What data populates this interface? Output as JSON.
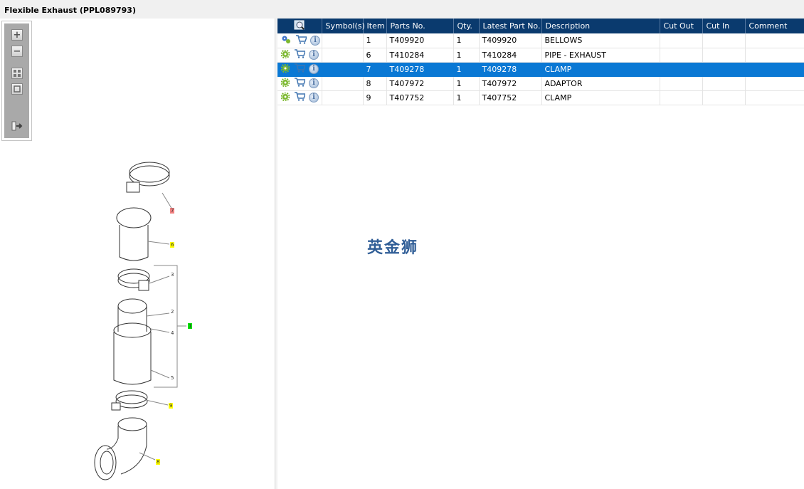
{
  "window": {
    "title": "Flexible Exhaust (PPL089793)"
  },
  "toolbar": {
    "items": [
      {
        "icon": "zoom-in-icon"
      },
      {
        "icon": "zoom-out-icon"
      },
      {
        "icon": "fit-all-icon"
      },
      {
        "icon": "actual-size-icon"
      },
      {
        "icon": "export-list-icon"
      }
    ]
  },
  "table": {
    "columns": [
      "Symbol(s)",
      "Item",
      "Parts No.",
      "Qty.",
      "Latest Part No.",
      "Description",
      "Cut Out",
      "Cut In",
      "Comment"
    ],
    "rows": [
      {
        "item": "1",
        "part": "T409920",
        "qty": "1",
        "latest": "T409920",
        "desc": "BELLOWS",
        "selected": false
      },
      {
        "item": "6",
        "part": "T410284",
        "qty": "1",
        "latest": "T410284",
        "desc": "PIPE - EXHAUST",
        "selected": false
      },
      {
        "item": "7",
        "part": "T409278",
        "qty": "1",
        "latest": "T409278",
        "desc": "CLAMP",
        "selected": true
      },
      {
        "item": "8",
        "part": "T407972",
        "qty": "1",
        "latest": "T407972",
        "desc": "ADAPTOR",
        "selected": false
      },
      {
        "item": "9",
        "part": "T407752",
        "qty": "1",
        "latest": "T407752",
        "desc": "CLAMP",
        "selected": false
      }
    ]
  },
  "diagram": {
    "callouts": [
      {
        "label": "7",
        "highlight": "#f08080"
      },
      {
        "label": "6",
        "highlight": "#ffff00"
      },
      {
        "label": "3",
        "highlight": ""
      },
      {
        "label": "2",
        "highlight": ""
      },
      {
        "label": "1",
        "highlight": "#00e000"
      },
      {
        "label": "4",
        "highlight": ""
      },
      {
        "label": "5",
        "highlight": ""
      },
      {
        "label": "9",
        "highlight": "#ffff00"
      },
      {
        "label": "8",
        "highlight": "#ffff00"
      }
    ]
  },
  "watermark": "英金狮",
  "colors": {
    "header": "#0a3a6e",
    "selection": "#0a78d4"
  }
}
